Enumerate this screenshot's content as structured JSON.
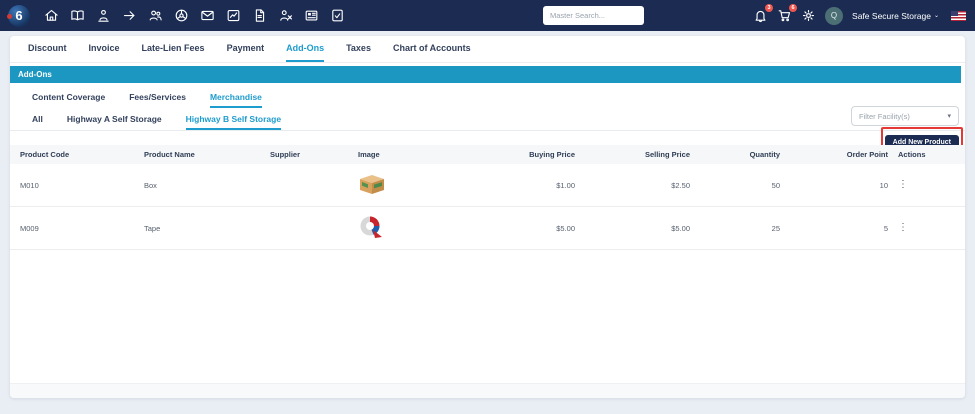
{
  "navbar": {
    "logo_text": "6",
    "icons": [
      "home",
      "map",
      "move-in",
      "arrow-right",
      "tenants",
      "units",
      "mail",
      "reports",
      "documents",
      "tenant-remove",
      "news",
      "tasks"
    ],
    "search_placeholder": "Master Search...",
    "notifications_badge": "3",
    "cart_badge": "6",
    "avatar_initial": "Q",
    "account_name": "Safe Secure Storage"
  },
  "tabs": {
    "items": [
      {
        "label": "Discount",
        "active": false
      },
      {
        "label": "Invoice",
        "active": false
      },
      {
        "label": "Late-Lien Fees",
        "active": false
      },
      {
        "label": "Payment",
        "active": false
      },
      {
        "label": "Add-Ons",
        "active": true
      },
      {
        "label": "Taxes",
        "active": false
      },
      {
        "label": "Chart of Accounts",
        "active": false
      }
    ]
  },
  "section": {
    "title": "Add-Ons"
  },
  "subtabs": {
    "items": [
      {
        "label": "Content Coverage",
        "active": false
      },
      {
        "label": "Fees/Services",
        "active": false
      },
      {
        "label": "Merchandise",
        "active": true
      }
    ]
  },
  "facility_tabs": {
    "items": [
      {
        "label": "All",
        "active": false
      },
      {
        "label": "Highway A Self Storage",
        "active": false
      },
      {
        "label": "Highway B Self Storage",
        "active": true
      }
    ]
  },
  "filters": {
    "facility_placeholder": "Filter Facility(s)"
  },
  "actions": {
    "add_new_product": "Add New Product"
  },
  "table": {
    "columns": [
      "Product Code",
      "Product Name",
      "Supplier",
      "Image",
      "Buying Price",
      "Selling Price",
      "Quantity",
      "Order Point",
      "Actions"
    ],
    "rows": [
      {
        "product_code": "M010",
        "product_name": "Box",
        "supplier": "",
        "image": "box",
        "buying_price": "$1.00",
        "selling_price": "$2.50",
        "quantity": "50",
        "order_point": "10"
      },
      {
        "product_code": "M009",
        "product_name": "Tape",
        "supplier": "",
        "image": "tape",
        "buying_price": "$5.00",
        "selling_price": "$5.00",
        "quantity": "25",
        "order_point": "5"
      }
    ]
  },
  "colors": {
    "navbar_navy": "#1b2b52",
    "section_teal": "#1b97c1",
    "active_tab_blue": "#1e9ccd",
    "badge_red": "#ee574f",
    "highlight_red": "#e53935"
  }
}
